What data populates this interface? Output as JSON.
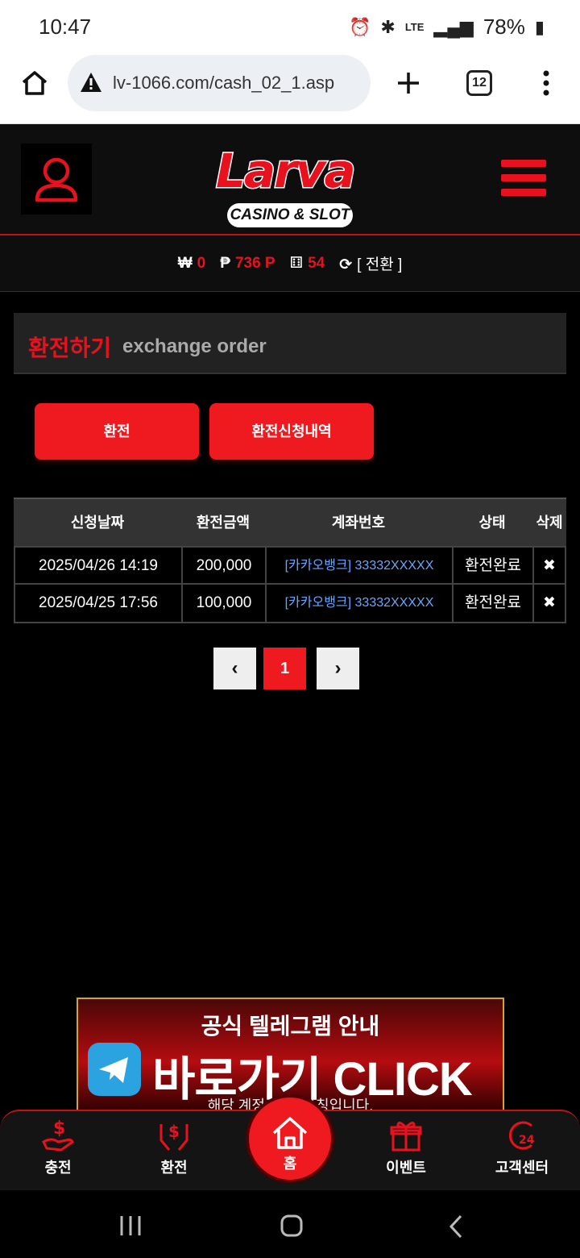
{
  "status": {
    "time": "10:47",
    "network": "LTE",
    "battery": "78%"
  },
  "browser": {
    "url": "lv-1066.com/cash_02_1.asp",
    "tabs": "12"
  },
  "header": {
    "logo_text": "Larva",
    "logo_sub": "CASINO & SLOT"
  },
  "balance": {
    "won_icon": "₩",
    "won": "0",
    "point_icon": "₱",
    "point": "736 P",
    "chips": "54",
    "toggle": "[ 전환 ]"
  },
  "section": {
    "title_ko": "환전하기",
    "title_en": "exchange order"
  },
  "buttons": {
    "exchange": "환전",
    "history": "환전신청내역"
  },
  "table": {
    "headers": [
      "신청날짜",
      "환전금액",
      "계좌번호",
      "상태",
      "삭제"
    ],
    "rows": [
      {
        "date": "2025/04/26 14:19",
        "amount": "200,000",
        "account": "[카카오뱅크] 33332XXXXX",
        "status": "환전완료",
        "delete": "✖"
      },
      {
        "date": "2025/04/25 17:56",
        "amount": "100,000",
        "account": "[카카오뱅크] 33332XXXXX",
        "status": "환전완료",
        "delete": "✖"
      }
    ]
  },
  "pagination": {
    "prev": "‹",
    "current": "1",
    "next": "›"
  },
  "banner": {
    "line1": "공식 텔레그램 안내",
    "line2": "바로가기 CLICK",
    "line3": "해당 계정 외 ... 사칭입니다."
  },
  "bottom_nav": {
    "charge": "충전",
    "exchange": "환전",
    "home": "홈",
    "event": "이벤트",
    "support": "고객센터"
  }
}
